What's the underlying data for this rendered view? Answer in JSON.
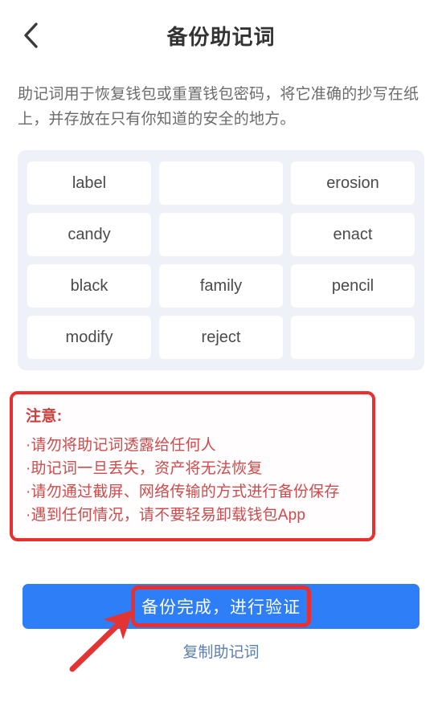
{
  "header": {
    "back_icon": "chevron-left-icon",
    "title": "备份助记词"
  },
  "description": "助记词用于恢复钱包或重置钱包密码，将它准确的抄写在纸上，并存放在只有你知道的安全的地方。",
  "mnemonic": {
    "columns": 3,
    "rows": 4,
    "words": [
      "label",
      "",
      "erosion",
      "candy",
      "",
      "enact",
      "black",
      "family",
      "pencil",
      "modify",
      "reject",
      ""
    ]
  },
  "warning": {
    "title": "注意:",
    "items": [
      "·请勿将助记词透露给任何人",
      "·助记词一旦丢失，资产将无法恢复",
      "·请勿通过截屏、网络传输的方式进行备份保存",
      "·遇到任何情况，请不要轻易卸载钱包App"
    ],
    "border_color": "#ea2f2f",
    "text_color": "#cf4b4b"
  },
  "actions": {
    "primary_label": "备份完成，进行验证",
    "primary_color": "#2d7ef7",
    "copy_label": "复制助记词",
    "copy_color": "#5b7fae"
  },
  "annotations": {
    "highlight_color": "#ea2f2f",
    "arrow_color": "#e33333"
  }
}
